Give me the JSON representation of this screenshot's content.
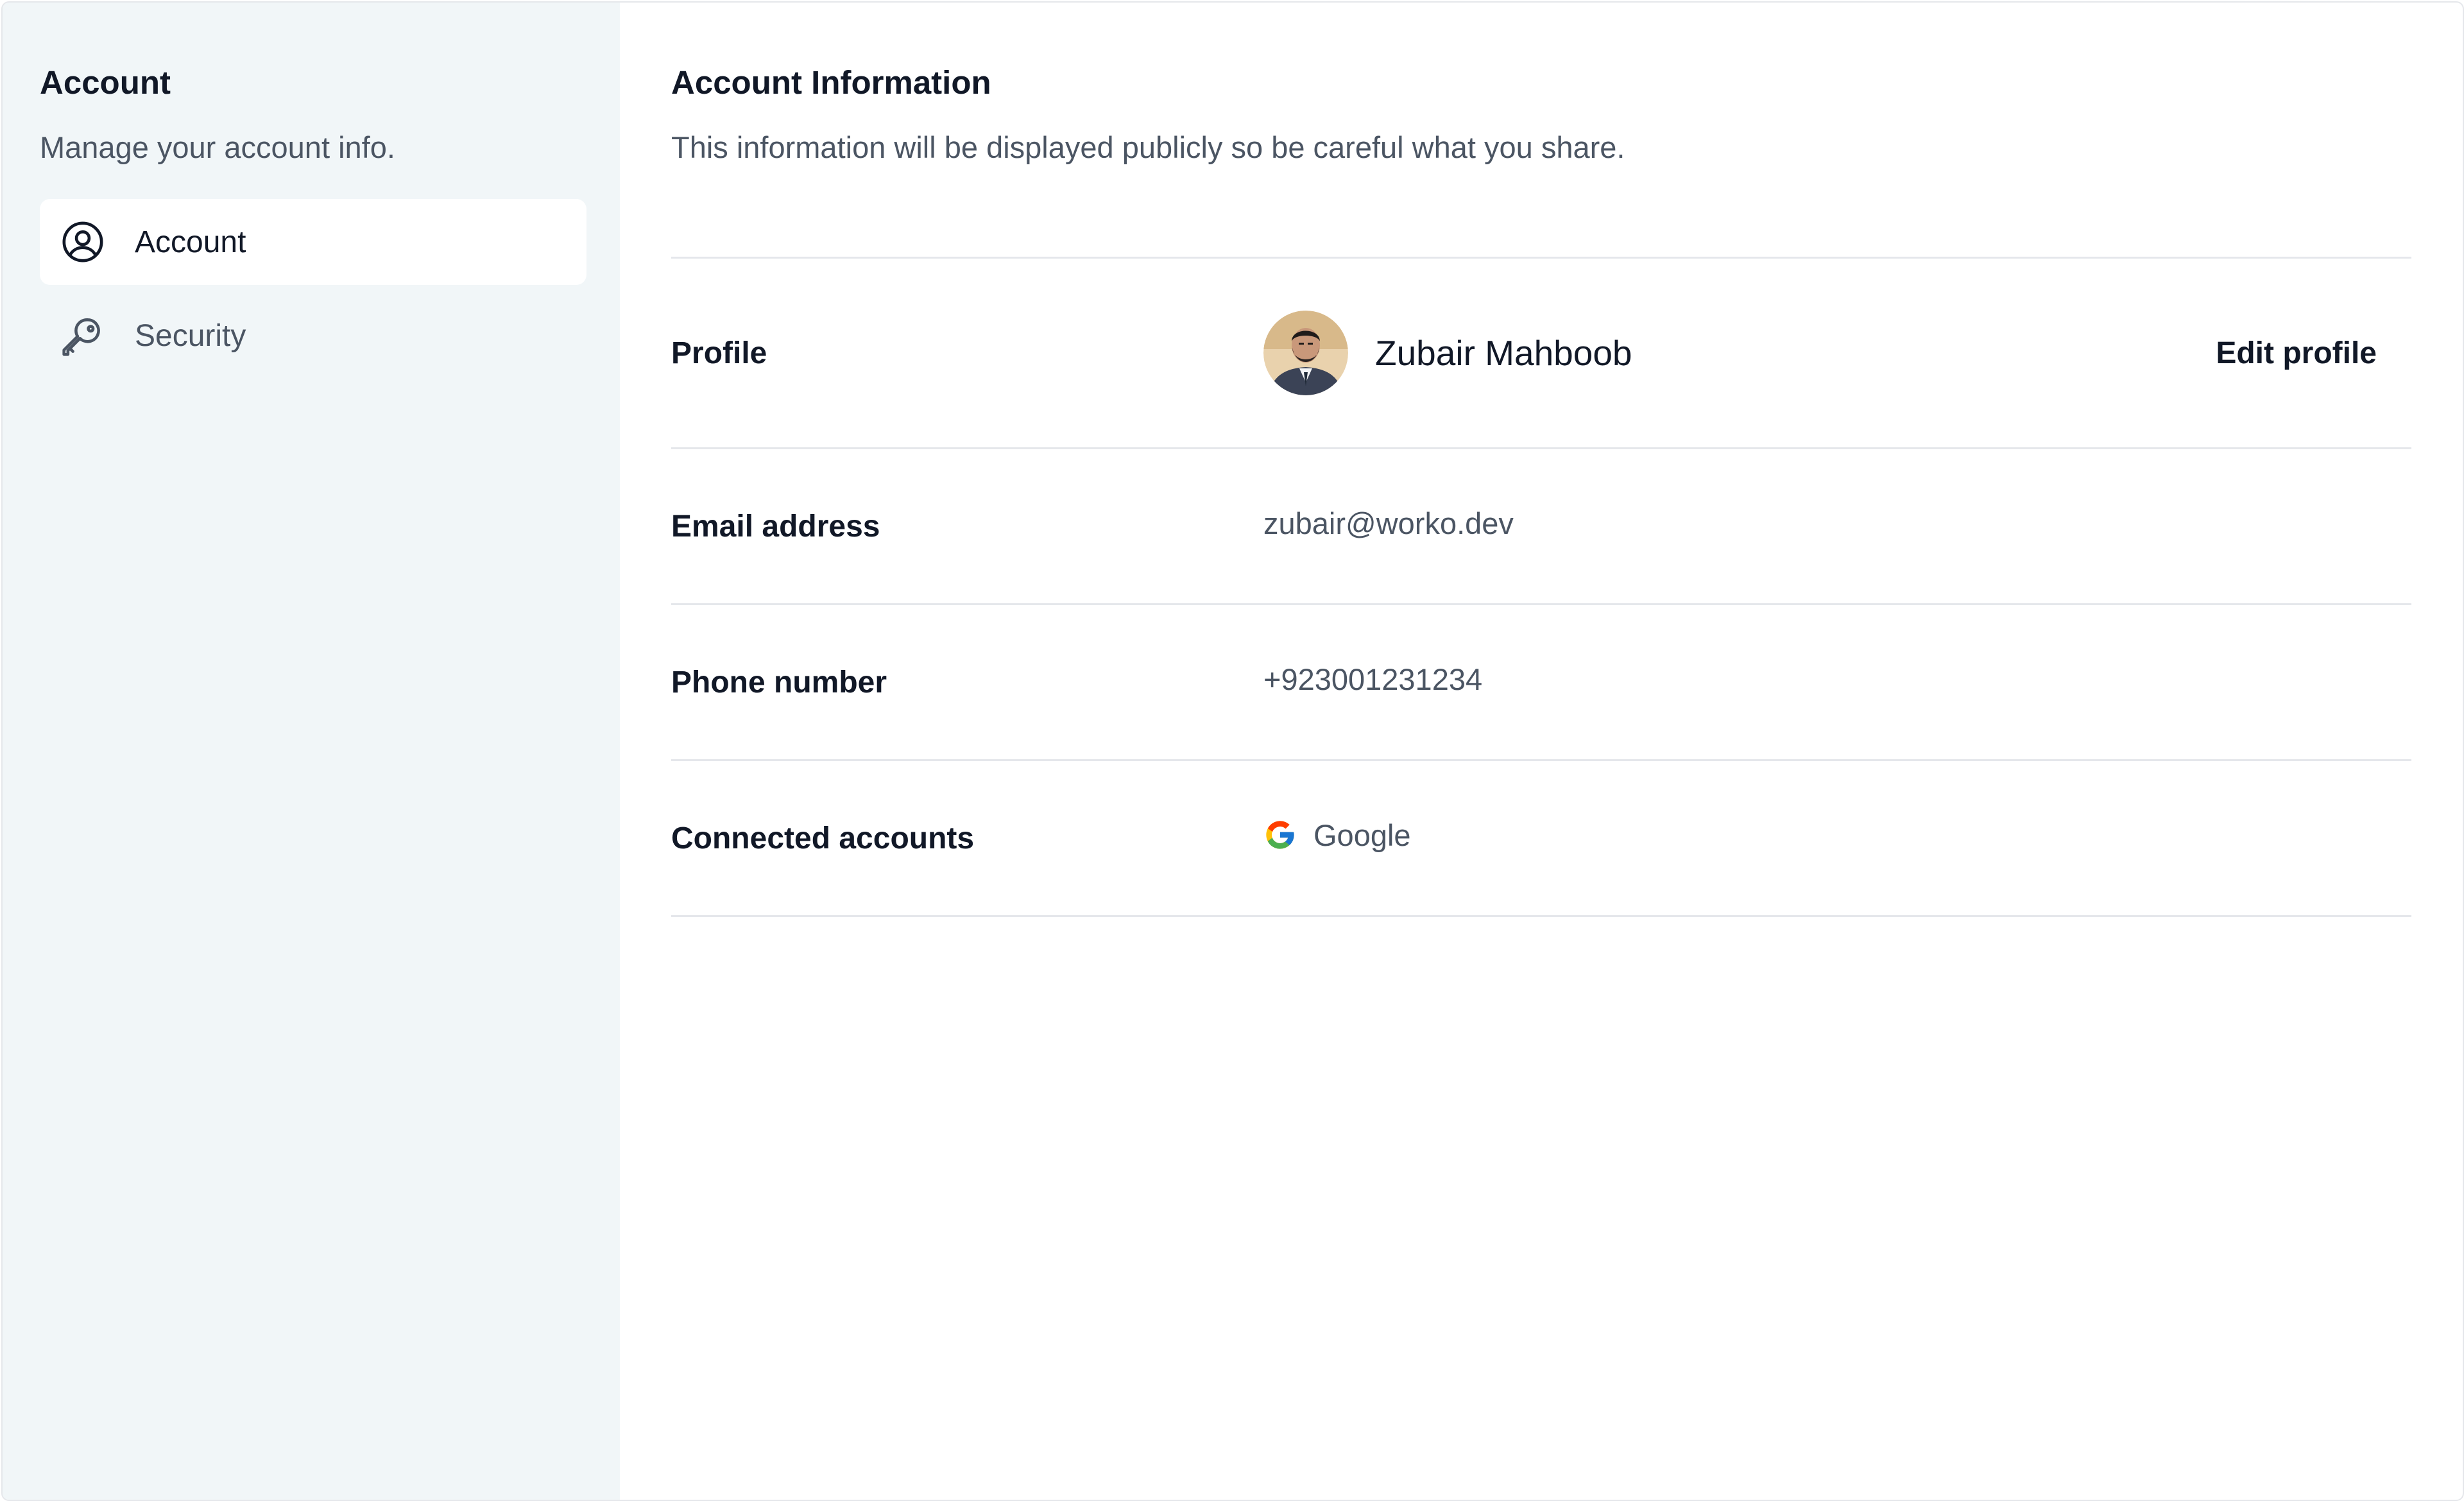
{
  "sidebar": {
    "title": "Account",
    "subtitle": "Manage your account info.",
    "items": [
      {
        "label": "Account",
        "icon": "user-circle-icon",
        "active": true
      },
      {
        "label": "Security",
        "icon": "key-icon",
        "active": false
      }
    ]
  },
  "main": {
    "title": "Account Information",
    "subtitle": "This information will be displayed publicly so be careful what you share.",
    "rows": {
      "profile": {
        "label": "Profile",
        "name": "Zubair Mahboob",
        "edit_label": "Edit profile"
      },
      "email": {
        "label": "Email address",
        "value": "zubair@worko.dev"
      },
      "phone": {
        "label": "Phone number",
        "value": "+923001231234"
      },
      "connected": {
        "label": "Connected accounts",
        "value": "Google",
        "icon": "google-icon"
      }
    }
  },
  "colors": {
    "sidebar_bg": "#f1f6f8",
    "text_primary": "#111827",
    "text_secondary": "#4b5563",
    "divider": "#e5e7eb"
  }
}
